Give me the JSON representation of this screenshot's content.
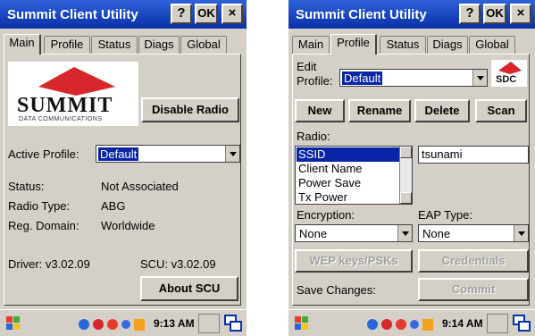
{
  "left": {
    "title": "Summit Client Utility",
    "title_buttons": {
      "help": "?",
      "ok": "OK",
      "close": "×"
    },
    "tabs": [
      "Main",
      "Profile",
      "Status",
      "Diags",
      "Global"
    ],
    "logo": {
      "brand": "SUMMIT",
      "sub": "DATA COMMUNICATIONS"
    },
    "disable_radio": "Disable Radio",
    "active_profile_label": "Active Profile:",
    "active_profile_value": "Default",
    "status_label": "Status:",
    "status_value": "Not Associated",
    "radio_type_label": "Radio Type:",
    "radio_type_value": "ABG",
    "reg_domain_label": "Reg. Domain:",
    "reg_domain_value": "Worldwide",
    "driver": "Driver:  v3.02.09",
    "scu": "SCU: v3.02.09",
    "about": "About SCU",
    "time": "9:13 AM"
  },
  "right": {
    "title": "Summit Client Utility",
    "title_buttons": {
      "help": "?",
      "ok": "OK",
      "close": "×"
    },
    "tabs": [
      "Main",
      "Profile",
      "Status",
      "Diags",
      "Global"
    ],
    "edit_profile_label_1": "Edit",
    "edit_profile_label_2": "Profile:",
    "edit_profile_value": "Default",
    "sdc_logo": "SDC",
    "buttons": {
      "new": "New",
      "rename": "Rename",
      "delete": "Delete",
      "scan": "Scan"
    },
    "radio_label": "Radio:",
    "radio_items": [
      "SSID",
      "Client Name",
      "Power Save",
      "Tx Power"
    ],
    "ssid_value": "tsunami",
    "encryption_label": "Encryption:",
    "encryption_value": "None",
    "eap_label": "EAP Type:",
    "eap_value": "None",
    "wep_button": "WEP keys/PSKs",
    "credentials_button": "Credentials",
    "save_changes_label": "Save Changes:",
    "commit_button": "Commit",
    "time": "9:14 AM"
  },
  "colors": {
    "titlebar": "#0a2fa8",
    "selection": "#0a24a8",
    "logo_red": "#d8262d",
    "face": "#d4d0c8"
  }
}
